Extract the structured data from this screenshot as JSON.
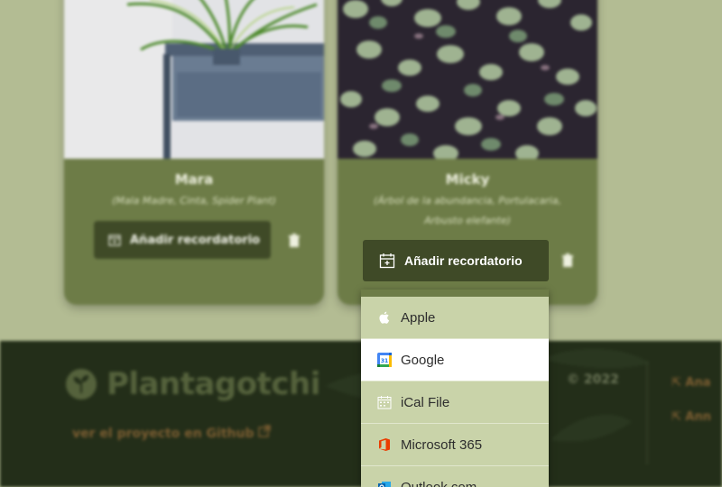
{
  "cards": [
    {
      "name": "Mara",
      "alt_names": "(Mala Madre, Cinta, Spider Plant)",
      "button_label": "Añadir recordatorio"
    },
    {
      "name": "Micky",
      "alt_names_line1": "(Árbol de la abundancia, Portulacaria,",
      "alt_names_line2": "Arbusto elefante)",
      "button_label": "Añadir recordatorio"
    }
  ],
  "calendar_menu": {
    "items": [
      {
        "label": "Apple",
        "icon": "apple-icon"
      },
      {
        "label": "Google",
        "icon": "google-calendar-icon"
      },
      {
        "label": "iCal File",
        "icon": "calendar-icon"
      },
      {
        "label": "Microsoft 365",
        "icon": "microsoft-office-icon"
      },
      {
        "label": "Outlook.com",
        "icon": "outlook-icon"
      }
    ],
    "highlighted_index": 1
  },
  "footer": {
    "brand": "Plantagotchi",
    "github_link": "ver el proyecto en Github",
    "copyright": "© 2022",
    "links": [
      "Ana",
      "Ann"
    ]
  },
  "colors": {
    "card": "#6d7c47",
    "button": "#3f4a27",
    "footer": "#232e19",
    "menu": "#c9d3a9",
    "page": "#b3bc93"
  }
}
